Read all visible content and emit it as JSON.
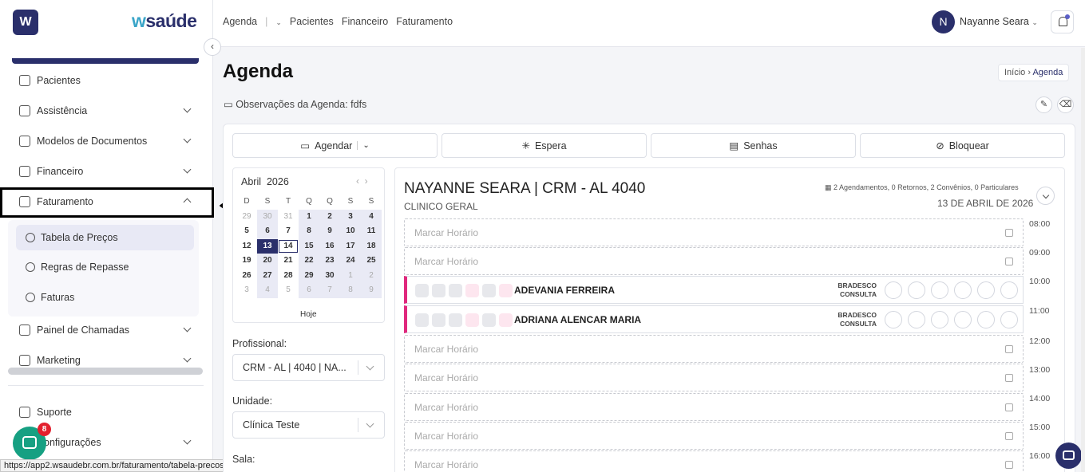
{
  "brand": {
    "logo_letter": "W",
    "prefix": "w",
    "name": "saúde"
  },
  "sidebar": {
    "items": [
      {
        "label": "Pacientes"
      },
      {
        "label": "Assistência"
      },
      {
        "label": "Modelos de Documentos"
      },
      {
        "label": "Financeiro"
      },
      {
        "label": "Faturamento"
      },
      {
        "label": "Painel de Chamadas"
      },
      {
        "label": "Marketing"
      },
      {
        "label": "Suporte"
      },
      {
        "label": "Configurações"
      }
    ],
    "sub_items": [
      {
        "label": "Tabela de Preços"
      },
      {
        "label": "Regras de Repasse"
      },
      {
        "label": "Faturas"
      }
    ],
    "chat_badge": "8"
  },
  "status_url": "https://app2.wsaudebr.com.br/faturamento/tabela-precos",
  "topnav": {
    "agenda": "Agenda",
    "sep": "|",
    "pacientes": "Pacientes",
    "financeiro": "Financeiro",
    "faturamento": "Faturamento"
  },
  "user": {
    "initial": "N",
    "name": "Nayanne Seara"
  },
  "page": {
    "title": "Agenda",
    "breadcrumb_home": "Início",
    "breadcrumb_current": "Agenda",
    "observacoes": "Observações da Agenda: fdfs"
  },
  "actions": {
    "agendar": "Agendar",
    "espera": "Espera",
    "senhas": "Senhas",
    "bloquear": "Bloquear"
  },
  "calendar": {
    "month": "Abril",
    "year": "2026",
    "weekdays": [
      "D",
      "S",
      "T",
      "Q",
      "Q",
      "S",
      "S"
    ],
    "weeks": [
      [
        "29",
        "30",
        "31",
        "1",
        "2",
        "3",
        "4"
      ],
      [
        "5",
        "6",
        "7",
        "8",
        "9",
        "10",
        "11"
      ],
      [
        "12",
        "13",
        "14",
        "15",
        "16",
        "17",
        "18"
      ],
      [
        "19",
        "20",
        "21",
        "22",
        "23",
        "24",
        "25"
      ],
      [
        "26",
        "27",
        "28",
        "29",
        "30",
        "1",
        "2"
      ],
      [
        "3",
        "4",
        "5",
        "6",
        "7",
        "8",
        "9"
      ]
    ],
    "today_label": "Hoje"
  },
  "filters": {
    "profissional_label": "Profissional:",
    "profissional_value": "CRM - AL | 4040 | NA...",
    "unidade_label": "Unidade:",
    "unidade_value": "Clínica Teste",
    "sala_label": "Sala:"
  },
  "schedule": {
    "doctor": "NAYANNE SEARA | CRM - AL 4040",
    "specialty": "CLINICO GERAL",
    "stats": "2 Agendamentos, 0 Retornos, 2 Convênios, 0 Particulares",
    "date": "13 DE ABRIL DE 2026",
    "empty_slot": "Marcar Horário",
    "appointments": [
      {
        "patient": "ADEVANIA FERREIRA",
        "convenio": "BRADESCO",
        "tipo": "CONSULTA"
      },
      {
        "patient": "ADRIANA ALENCAR MARIA",
        "convenio": "BRADESCO",
        "tipo": "CONSULTA"
      }
    ],
    "hours": [
      "08:00",
      "09:00",
      "10:00",
      "11:00",
      "12:00",
      "13:00",
      "14:00",
      "15:00",
      "16:00"
    ]
  }
}
